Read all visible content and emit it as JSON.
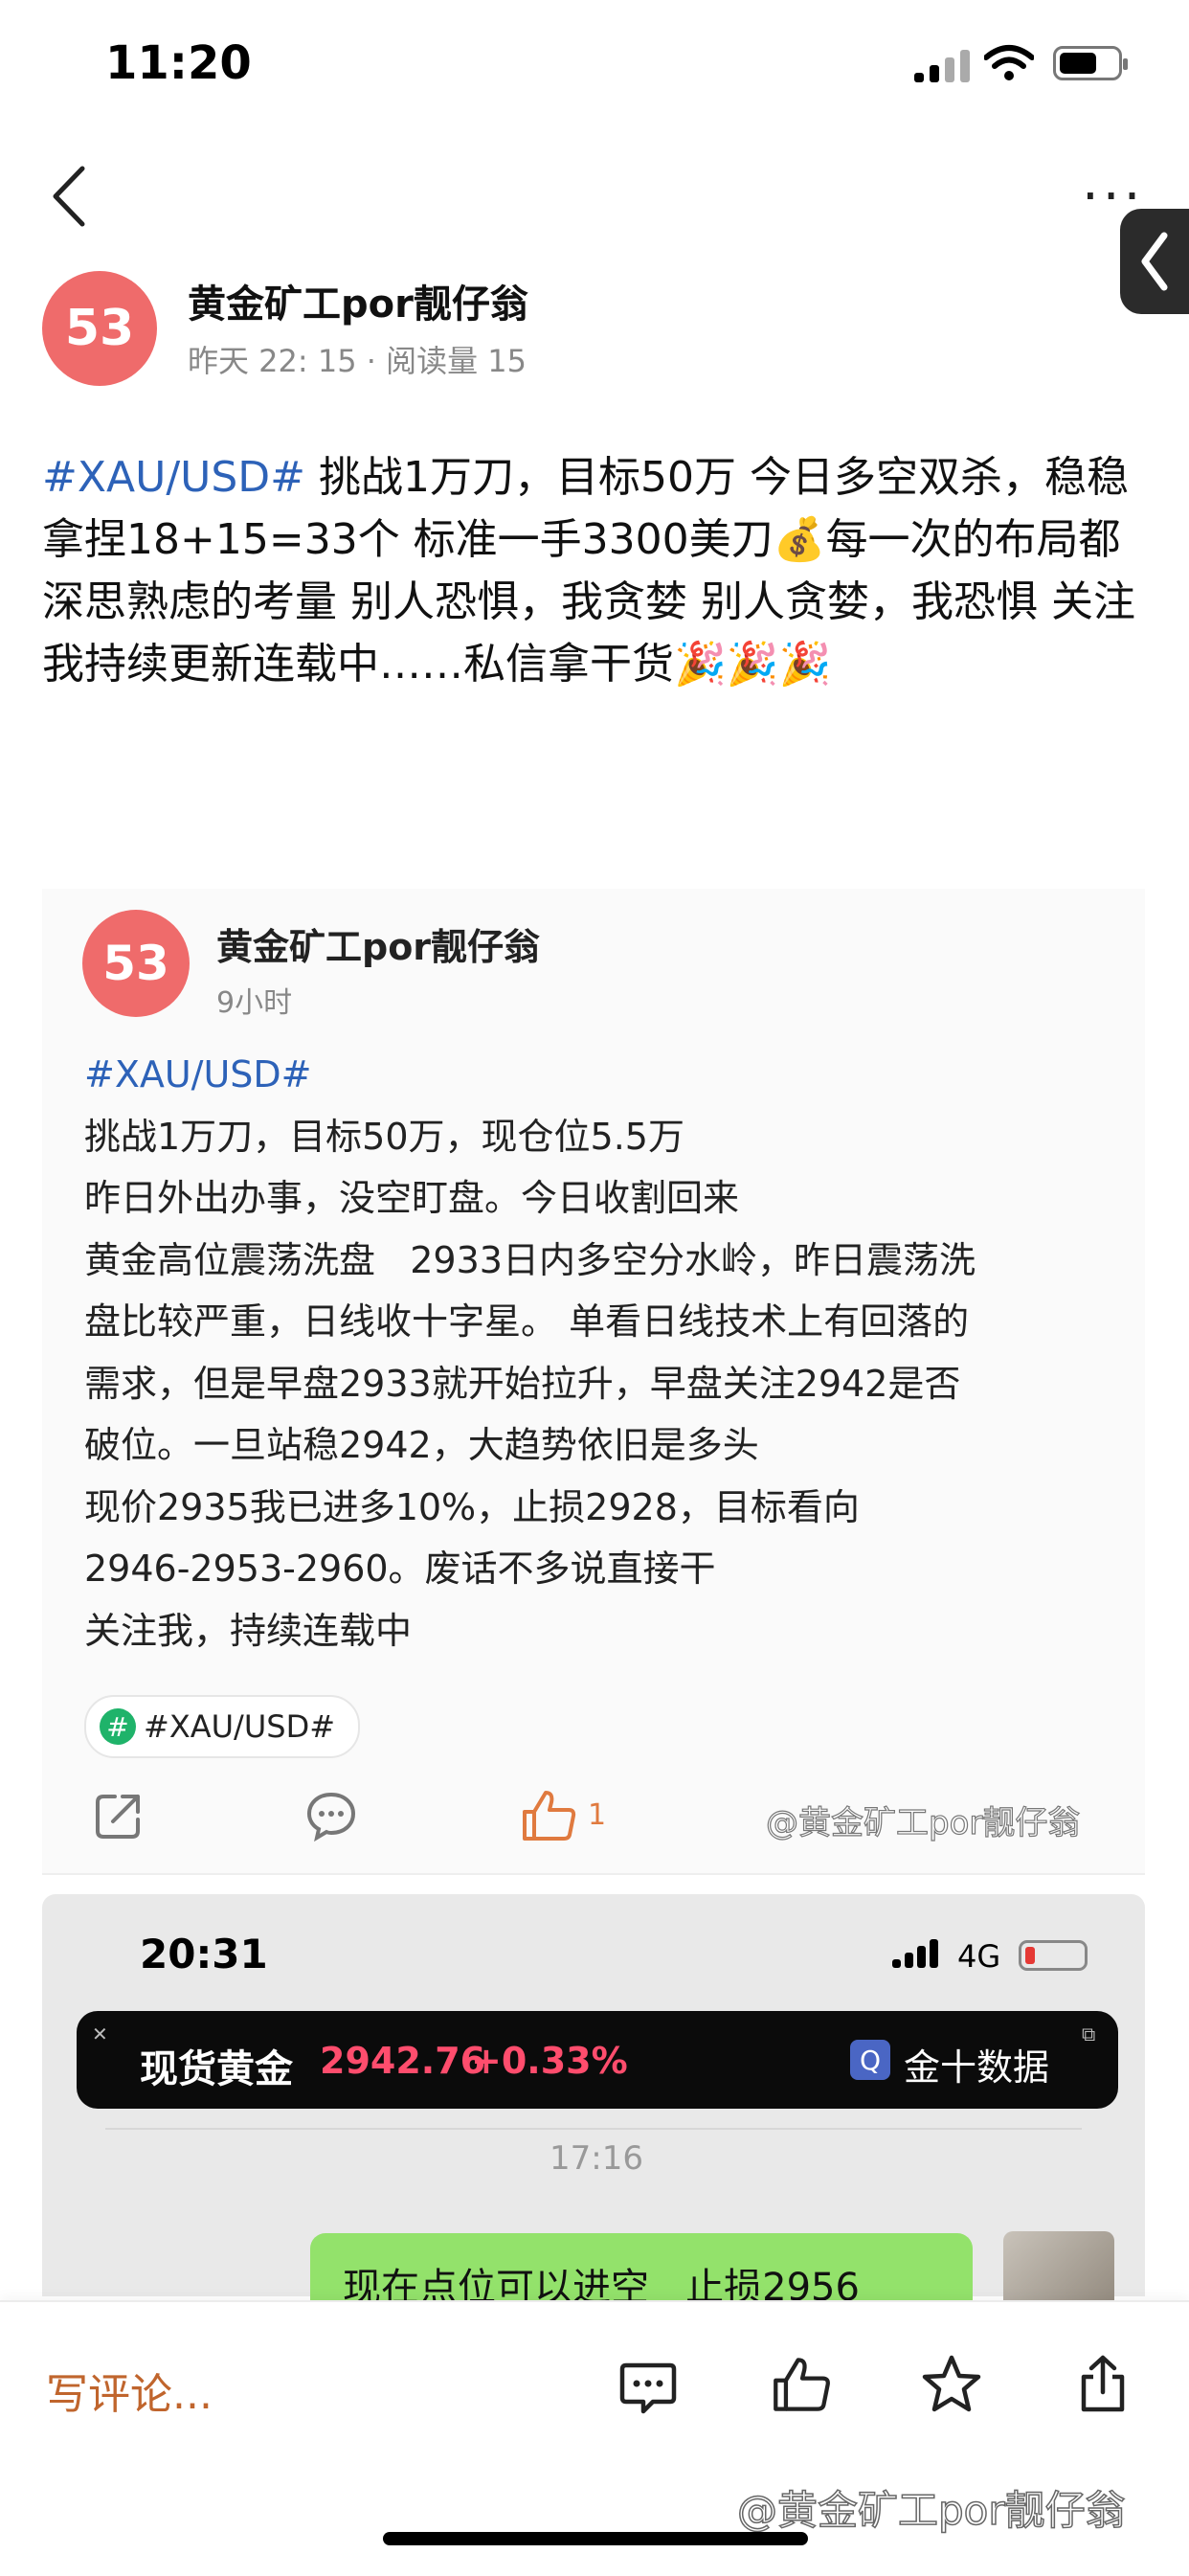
{
  "status_bar": {
    "time": "11:20"
  },
  "nav": {
    "back_icon": "chevron-left-icon",
    "more_icon": "more-dots-icon",
    "more_label": "···"
  },
  "post": {
    "avatar_text": "53",
    "author": "黄金矿工por靓仔翁",
    "meta": "昨天 22: 15 · 阅读量 15",
    "hashtag": "#XAU/USD#",
    "body": " 挑战1万刀，目标50万 今日多空双杀，稳稳拿捏18+15=33个 标准一手3300美刀💰每一次的布局都深思熟虑的考量 别人恐惧，我贪婪 别人贪婪，我恐惧 关注我持续更新连载中……私信拿干货🎉🎉🎉"
  },
  "quoted": {
    "avatar_text": "53",
    "author": "黄金矿工por靓仔翁",
    "time": "9小时",
    "hashtag": "#XAU/USD#",
    "lines": [
      "挑战1万刀，目标50万，现仓位5.5万",
      "昨日外出办事，没空盯盘。今日收割回来",
      "黄金高位震荡洗盘   2933日内多空分水岭，昨日震荡洗",
      "盘比较严重，日线收十字星。 单看日线技术上有回落的",
      "需求，但是早盘2933就开始拉升，早盘关注2942是否",
      "破位。一旦站稳2942，大趋势依旧是多头",
      "现价2935我已进多10%，止损2928，目标看向",
      "2946-2953-2960。废话不多说直接干",
      "关注我，持续连载中"
    ],
    "topic_badge": "#XAU/USD#",
    "topic_icon_text": "#",
    "like_count": "1",
    "watermark": "@黄金矿工por靓仔翁",
    "actions": {
      "share_icon": "share-icon",
      "comment_icon": "comment-icon",
      "like_icon": "thumbs-up-icon"
    }
  },
  "embedded": {
    "time": "20:31",
    "network": "4G",
    "ticker": {
      "label": "现货黄金",
      "price": "2942.76",
      "change": "+0.33%",
      "source": "金十数据",
      "close": "✕",
      "expand": "⧉",
      "logo": "Q"
    },
    "chat_time": "17:16",
    "message": "现在点位可以进空   止损2956"
  },
  "bottom_bar": {
    "comment_placeholder": "写评论...",
    "watermark": "@黄金矿工por靓仔翁",
    "icons": [
      "comment-icon",
      "thumbs-up-icon",
      "star-icon",
      "share-icon"
    ]
  },
  "colors": {
    "accent": "#2d62b8",
    "avatar": "#ef6b6b",
    "like": "#e07a3f",
    "ticker_up": "#ff4d6d",
    "bubble": "#93e26b"
  }
}
